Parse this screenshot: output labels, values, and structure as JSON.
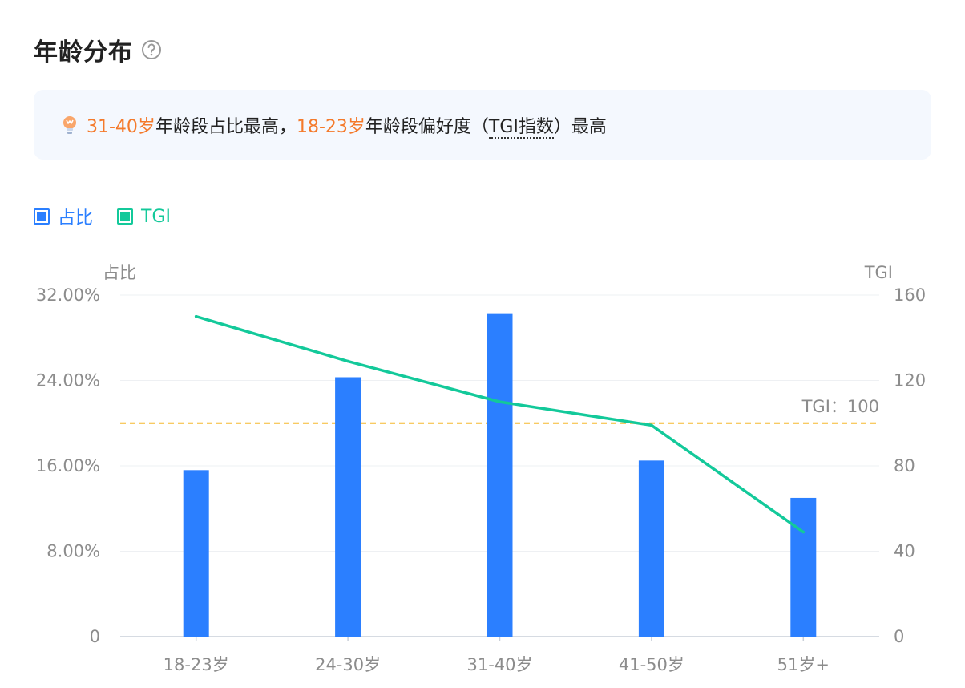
{
  "header": {
    "title": "年龄分布",
    "help_icon": "question-circle-icon"
  },
  "banner": {
    "icon": "lightbulb-icon",
    "hl1": "31-40岁",
    "text1": "年龄段占比最高，",
    "hl2": "18-23岁",
    "text2": "年龄段偏好度（",
    "tgi_term": "TGI指数",
    "text3": "）最高",
    "highlight_color": "#f47a2b"
  },
  "legend": [
    {
      "label": "占比",
      "color": "#2b7fff"
    },
    {
      "label": "TGI",
      "color": "#13c99a"
    }
  ],
  "chart_data": {
    "type": "bar",
    "categories": [
      "18-23岁",
      "24-30岁",
      "31-40岁",
      "41-50岁",
      "51岁+"
    ],
    "series": [
      {
        "name": "占比",
        "type": "bar",
        "axis": "left",
        "values": [
          15.6,
          24.3,
          30.3,
          16.5,
          13.0
        ],
        "color": "#2b7fff"
      },
      {
        "name": "TGI",
        "type": "line",
        "axis": "right",
        "values": [
          150,
          129,
          110,
          99,
          49
        ],
        "color": "#13c99a"
      }
    ],
    "left_axis": {
      "label": "占比",
      "min": 0,
      "max": 32,
      "ticks": [
        "0",
        "8.00%",
        "16.00%",
        "24.00%",
        "32.00%"
      ]
    },
    "right_axis": {
      "label": "TGI",
      "min": 0,
      "max": 160,
      "ticks": [
        "0",
        "40",
        "80",
        "120",
        "160"
      ]
    },
    "reference_line": {
      "value": 100,
      "label": "TGI：100",
      "color": "#f5b82e",
      "style": "dashed"
    },
    "grid": true
  }
}
